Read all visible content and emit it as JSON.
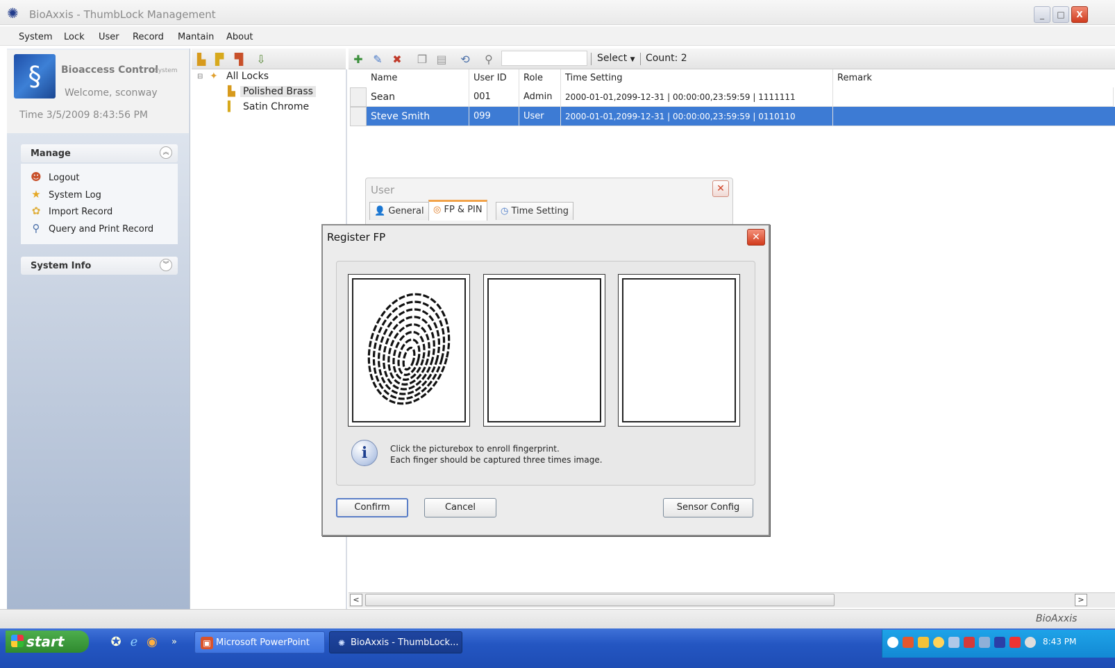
{
  "window": {
    "title": "BioAxxis - ThumbLock Management",
    "controls": [
      "_",
      "□",
      "X"
    ]
  },
  "menu": [
    "System",
    "Lock",
    "User",
    "Record",
    "Mantain",
    "About"
  ],
  "sidebar": {
    "brand_name": "Bioaccess Control",
    "brand_sub": "System",
    "welcome": "Welcome, sconway",
    "time": "Time  3/5/2009 8:43:56 PM",
    "manage": {
      "title": "Manage",
      "items": [
        "Logout",
        "System Log",
        "Import Record",
        "Query and Print Record"
      ]
    },
    "system_info": {
      "title": "System Info"
    }
  },
  "tree": {
    "root": "All Locks",
    "nodes": [
      "Polished Brass",
      "Satin Chrome"
    ]
  },
  "toolbar": {
    "select_label": "Select",
    "count_label": "Count:",
    "count_value": "2"
  },
  "grid": {
    "columns": [
      "Name",
      "User ID",
      "Role",
      "Time Setting",
      "Remark"
    ],
    "rows": [
      [
        "Sean",
        "001",
        "Admin",
        "2000-01-01,2099-12-31 | 00:00:00,23:59:59 | 1111111",
        ""
      ],
      [
        "Steve Smith",
        "099",
        "User",
        "2000-01-01,2099-12-31 | 00:00:00,23:59:59 | 0110110",
        ""
      ]
    ],
    "selected_row": 1
  },
  "status_bar": {
    "text": "BioAxxis"
  },
  "user_dialog": {
    "title": "User",
    "tabs": [
      "General",
      "FP & PIN",
      "Time Setting"
    ],
    "active_tab": 1
  },
  "register_dialog": {
    "title": "Register FP",
    "hint_line1": "Click the picturebox to enroll fingerprint.",
    "hint_line2": "Each finger should be captured three times image.",
    "buttons": {
      "confirm": "Confirm",
      "cancel": "Cancel",
      "sensor": "Sensor Config"
    },
    "captures": 1
  },
  "taskbar": {
    "start": "start",
    "tasks": [
      "Microsoft PowerPoint",
      "BioAxxis - ThumbLock..."
    ],
    "clock": "8:43 PM"
  },
  "colors": {
    "selection": "#3d7bd4",
    "taskbar": "#2456c2",
    "start": "#3a9b3a"
  }
}
